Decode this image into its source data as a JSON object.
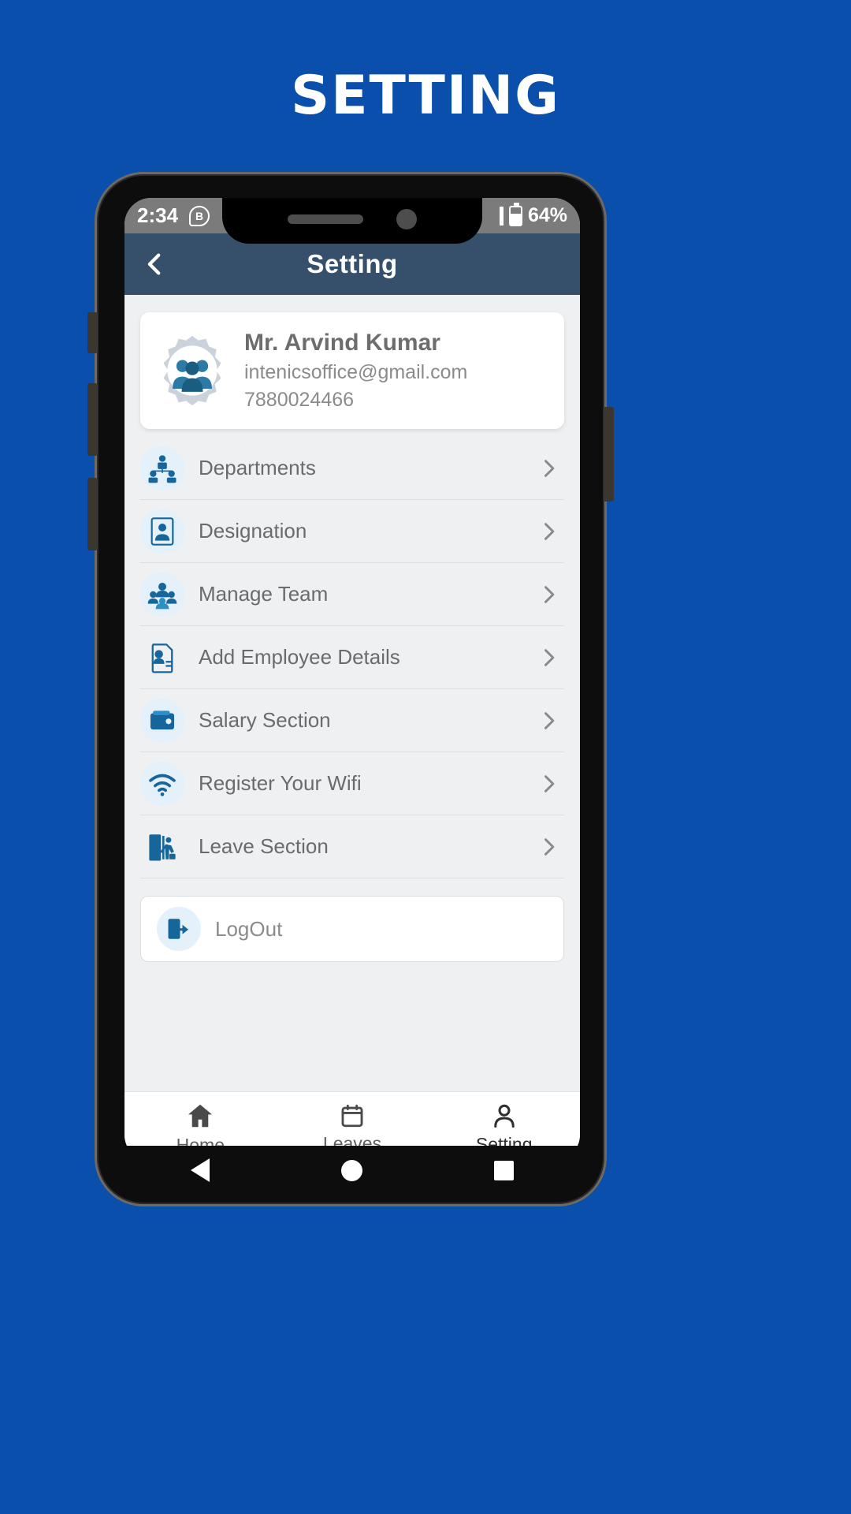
{
  "poster": {
    "title": "SETTING",
    "background_color": "#0a4fab"
  },
  "status_bar": {
    "time": "2:34",
    "whatsapp_icon": "whatsapp-icon",
    "whatsapp_glyph": "B",
    "battery_percent": "64%",
    "signal_icon": "signal-icon",
    "battery_icon": "battery-icon"
  },
  "header": {
    "back_icon": "back-chevron-icon",
    "title": "Setting",
    "background_color": "#36506b"
  },
  "profile": {
    "avatar_icon": "team-gear-avatar-icon",
    "name": "Mr. Arvind Kumar",
    "email": "intenicsoffice@gmail.com",
    "phone": "7880024466"
  },
  "menu": {
    "items": [
      {
        "label": "Departments",
        "icon": "departments-icon",
        "chevron": "chevron-right-icon"
      },
      {
        "label": "Designation",
        "icon": "designation-icon",
        "chevron": "chevron-right-icon"
      },
      {
        "label": "Manage Team",
        "icon": "manage-team-icon",
        "chevron": "chevron-right-icon"
      },
      {
        "label": "Add Employee Details",
        "icon": "add-employee-icon",
        "chevron": "chevron-right-icon"
      },
      {
        "label": "Salary Section",
        "icon": "wallet-icon",
        "chevron": "chevron-right-icon"
      },
      {
        "label": "Register Your Wifi",
        "icon": "wifi-icon",
        "chevron": "chevron-right-icon"
      },
      {
        "label": "Leave Section",
        "icon": "leave-door-icon",
        "chevron": "chevron-right-icon"
      }
    ]
  },
  "logout": {
    "label": "LogOut",
    "icon": "logout-icon"
  },
  "bottom_nav": {
    "items": [
      {
        "label": "Home",
        "icon": "home-icon",
        "active": false
      },
      {
        "label": "Leaves",
        "icon": "calendar-icon",
        "active": false
      },
      {
        "label": "Setting",
        "icon": "person-icon",
        "active": true
      }
    ]
  },
  "android_nav": {
    "back": "android-back-icon",
    "home": "android-home-icon",
    "recents": "android-recents-icon"
  },
  "colors": {
    "brand_blue": "#0a4fab",
    "header_slate": "#36506b",
    "icon_blue": "#16669c",
    "icon_bg": "#e4f1fb",
    "body_bg": "#eef0f2"
  }
}
